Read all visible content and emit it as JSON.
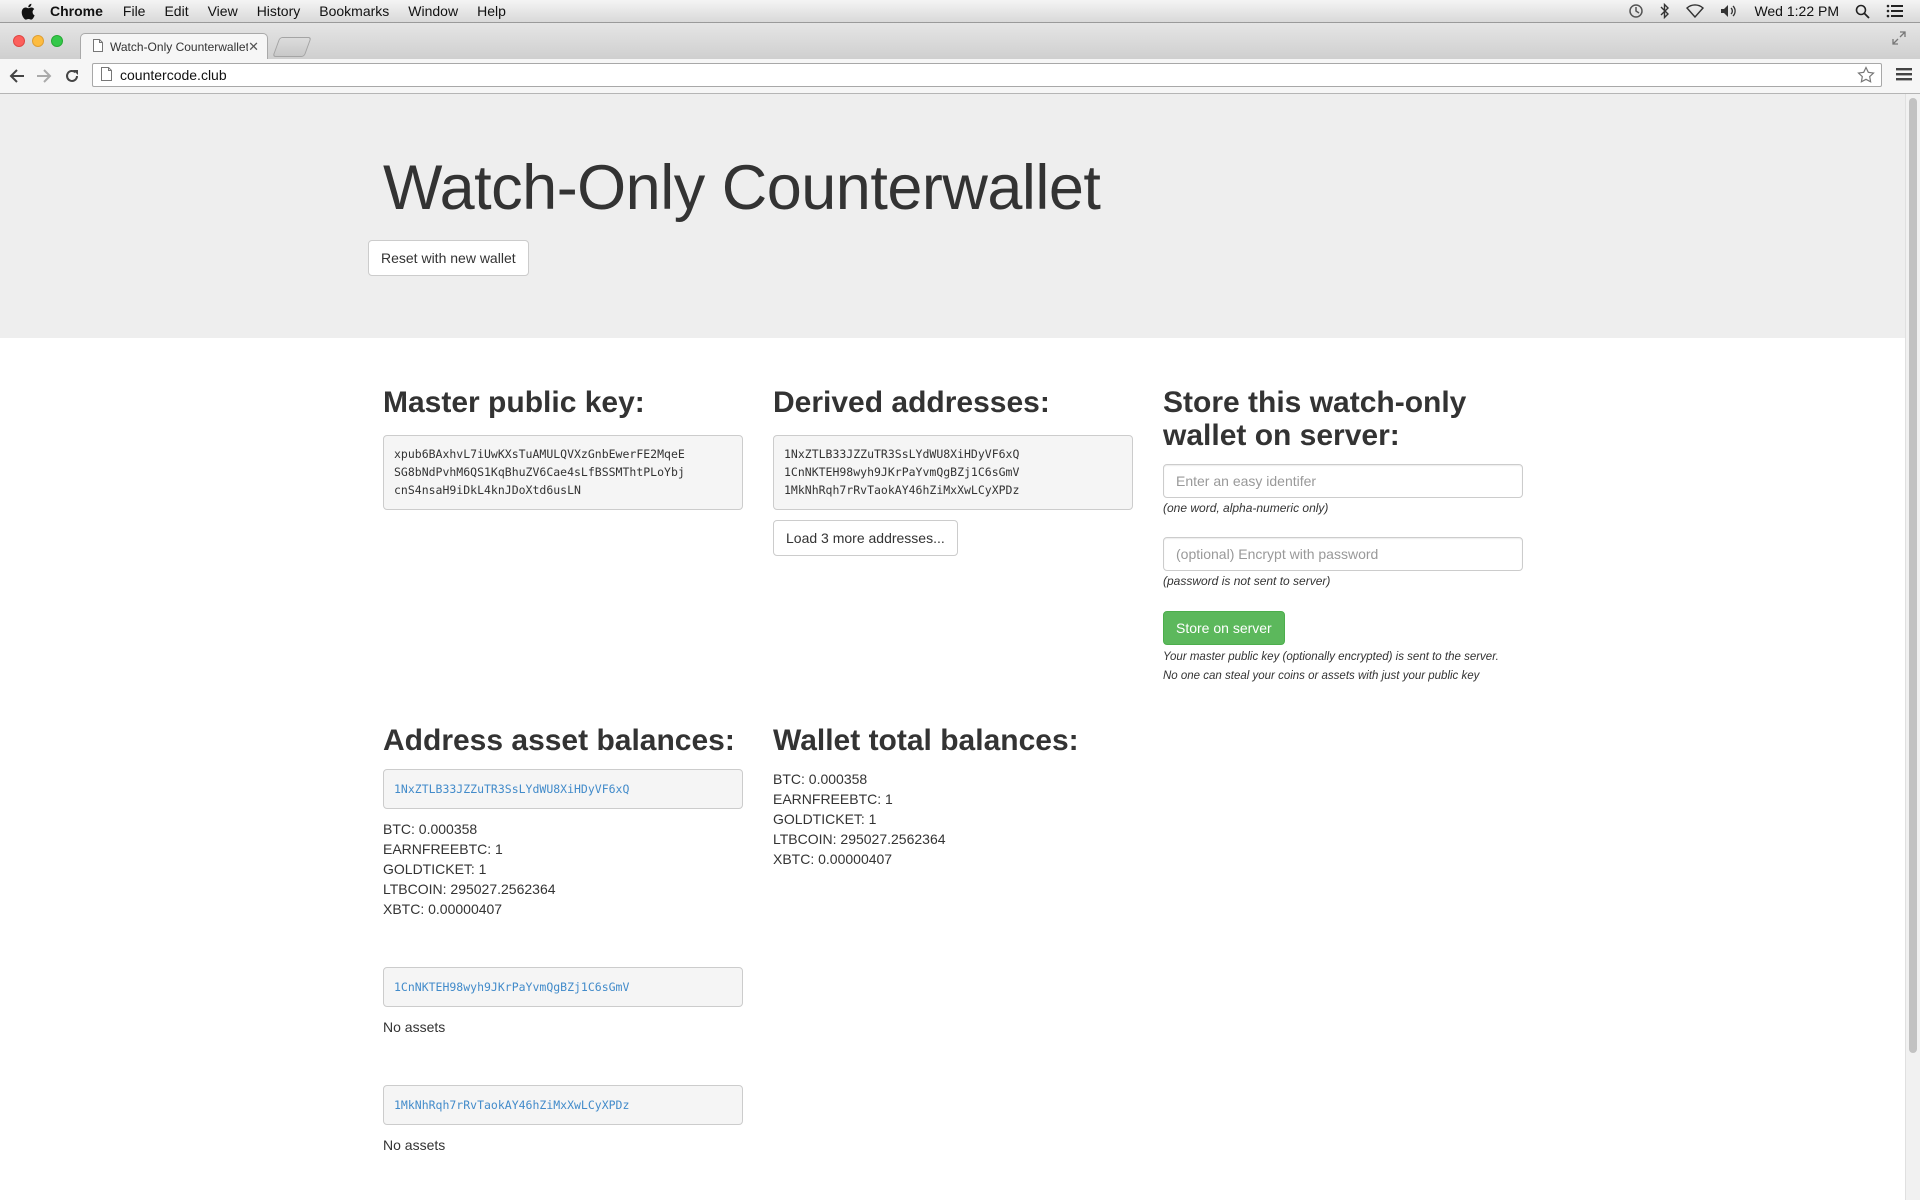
{
  "menubar": {
    "app": "Chrome",
    "menus": [
      "File",
      "Edit",
      "View",
      "History",
      "Bookmarks",
      "Window",
      "Help"
    ],
    "clock": "Wed 1:22 PM"
  },
  "browser": {
    "tab_title": "Watch-Only Counterwallet",
    "url": "countercode.club"
  },
  "page": {
    "title": "Watch-Only Counterwallet",
    "reset_button": "Reset with new wallet",
    "master_key": {
      "heading": "Master public key:",
      "value": "xpub6BAxhvL7iUwKXsTuAMULQVXzGnbEwerFE2MqeE\nSG8bNdPvhM6QS1KqBhuZV6Cae4sLfBSSMThtPLoYbj\ncnS4nsaH9iDkL4knJDoXtd6usLN"
    },
    "derived": {
      "heading": "Derived addresses:",
      "addresses_text": "1NxZTLB33JZZuTR3SsLYdWU8XiHDyVF6xQ\n1CnNKTEH98wyh9JKrPaYvmQgBZj1C6sGmV\n1MkNhRqh7rRvTaokAY46hZiMxXwLCyXPDz",
      "load_more_button": "Load 3 more addresses..."
    },
    "store": {
      "heading": "Store this watch-only wallet on server:",
      "identifier_placeholder": "Enter an easy identifer",
      "identifier_help": "(one word, alpha-numeric only)",
      "password_placeholder": "(optional) Encrypt with password",
      "password_help": "(password is not sent to server)",
      "store_button": "Store on server",
      "note_line1": "Your master public key (optionally encrypted) is sent to the server.",
      "note_line2": "No one can steal your coins or assets with just your public key"
    },
    "address_balances": {
      "heading": "Address asset balances:",
      "entries": [
        {
          "address": "1NxZTLB33JZZuTR3SsLYdWU8XiHDyVF6xQ",
          "balances": [
            "BTC: 0.000358",
            "EARNFREEBTC: 1",
            "GOLDTICKET: 1",
            "LTBCOIN: 295027.2562364",
            "XBTC: 0.00000407"
          ]
        },
        {
          "address": "1CnNKTEH98wyh9JKrPaYvmQgBZj1C6sGmV",
          "balances": [
            "No assets"
          ]
        },
        {
          "address": "1MkNhRqh7rRvTaokAY46hZiMxXwLCyXPDz",
          "balances": [
            "No assets"
          ]
        }
      ]
    },
    "wallet_totals": {
      "heading": "Wallet total balances:",
      "balances": [
        "BTC: 0.000358",
        "EARNFREEBTC: 1",
        "GOLDTICKET: 1",
        "LTBCOIN: 295027.2562364",
        "XBTC: 0.00000407"
      ]
    }
  },
  "colors": {
    "jumbotron_bg": "#eeeeee",
    "link_blue": "#428bca",
    "success_green": "#5cb85c"
  },
  "icons": [
    "apple-icon",
    "time-machine-icon",
    "bluetooth-icon",
    "wifi-icon",
    "volume-icon",
    "spotlight-icon",
    "notification-center-icon",
    "back-icon",
    "forward-icon",
    "reload-icon",
    "page-icon",
    "star-icon",
    "chrome-menu-icon",
    "fullscreen-icon",
    "close-icon"
  ]
}
